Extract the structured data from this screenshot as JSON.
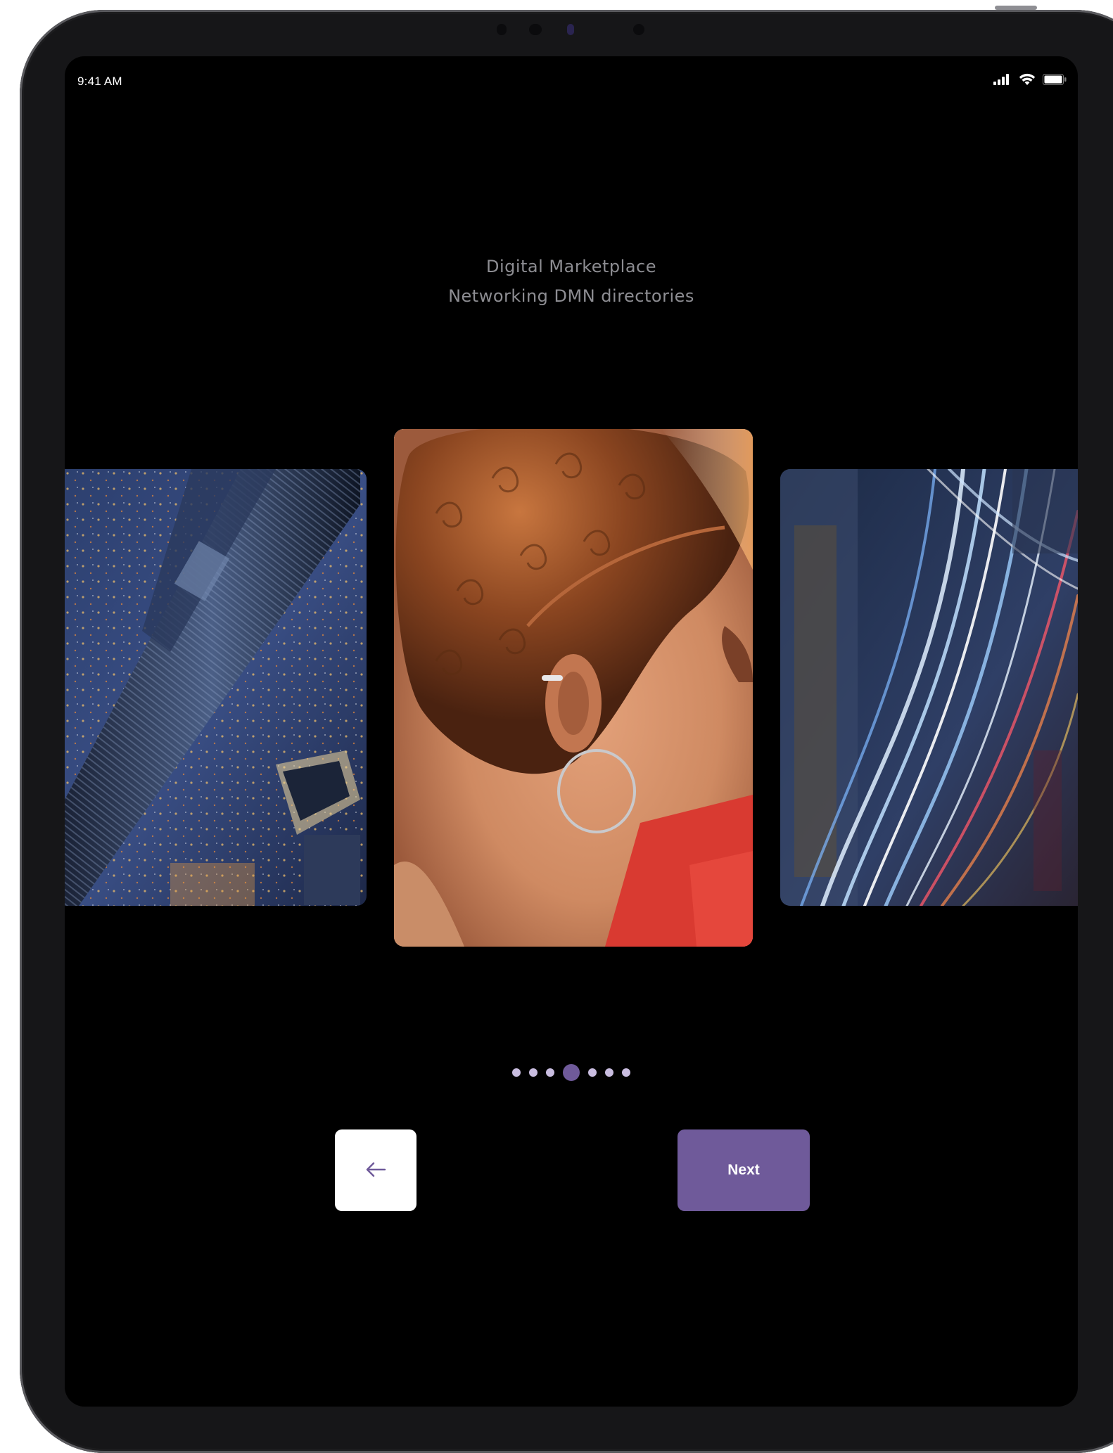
{
  "status_bar": {
    "time": "9:41 AM",
    "icons": [
      "cellular-signal-icon",
      "wifi-icon",
      "battery-icon"
    ]
  },
  "headline": {
    "line1": "Digital Marketplace",
    "line2": "Networking DMN directories"
  },
  "carousel": {
    "slides": [
      {
        "name": "aerial-skyscraper-photo"
      },
      {
        "name": "portrait-hoop-earring-photo"
      },
      {
        "name": "light-trails-highway-photo"
      }
    ],
    "page_count": 7,
    "active_page": 4
  },
  "buttons": {
    "back_icon": "arrow-left-icon",
    "next_label": "Next"
  },
  "colors": {
    "accent": "#6f5a9a",
    "dot_inactive": "#c9bde0",
    "headline_text": "#8d8d92",
    "background": "#000000"
  }
}
